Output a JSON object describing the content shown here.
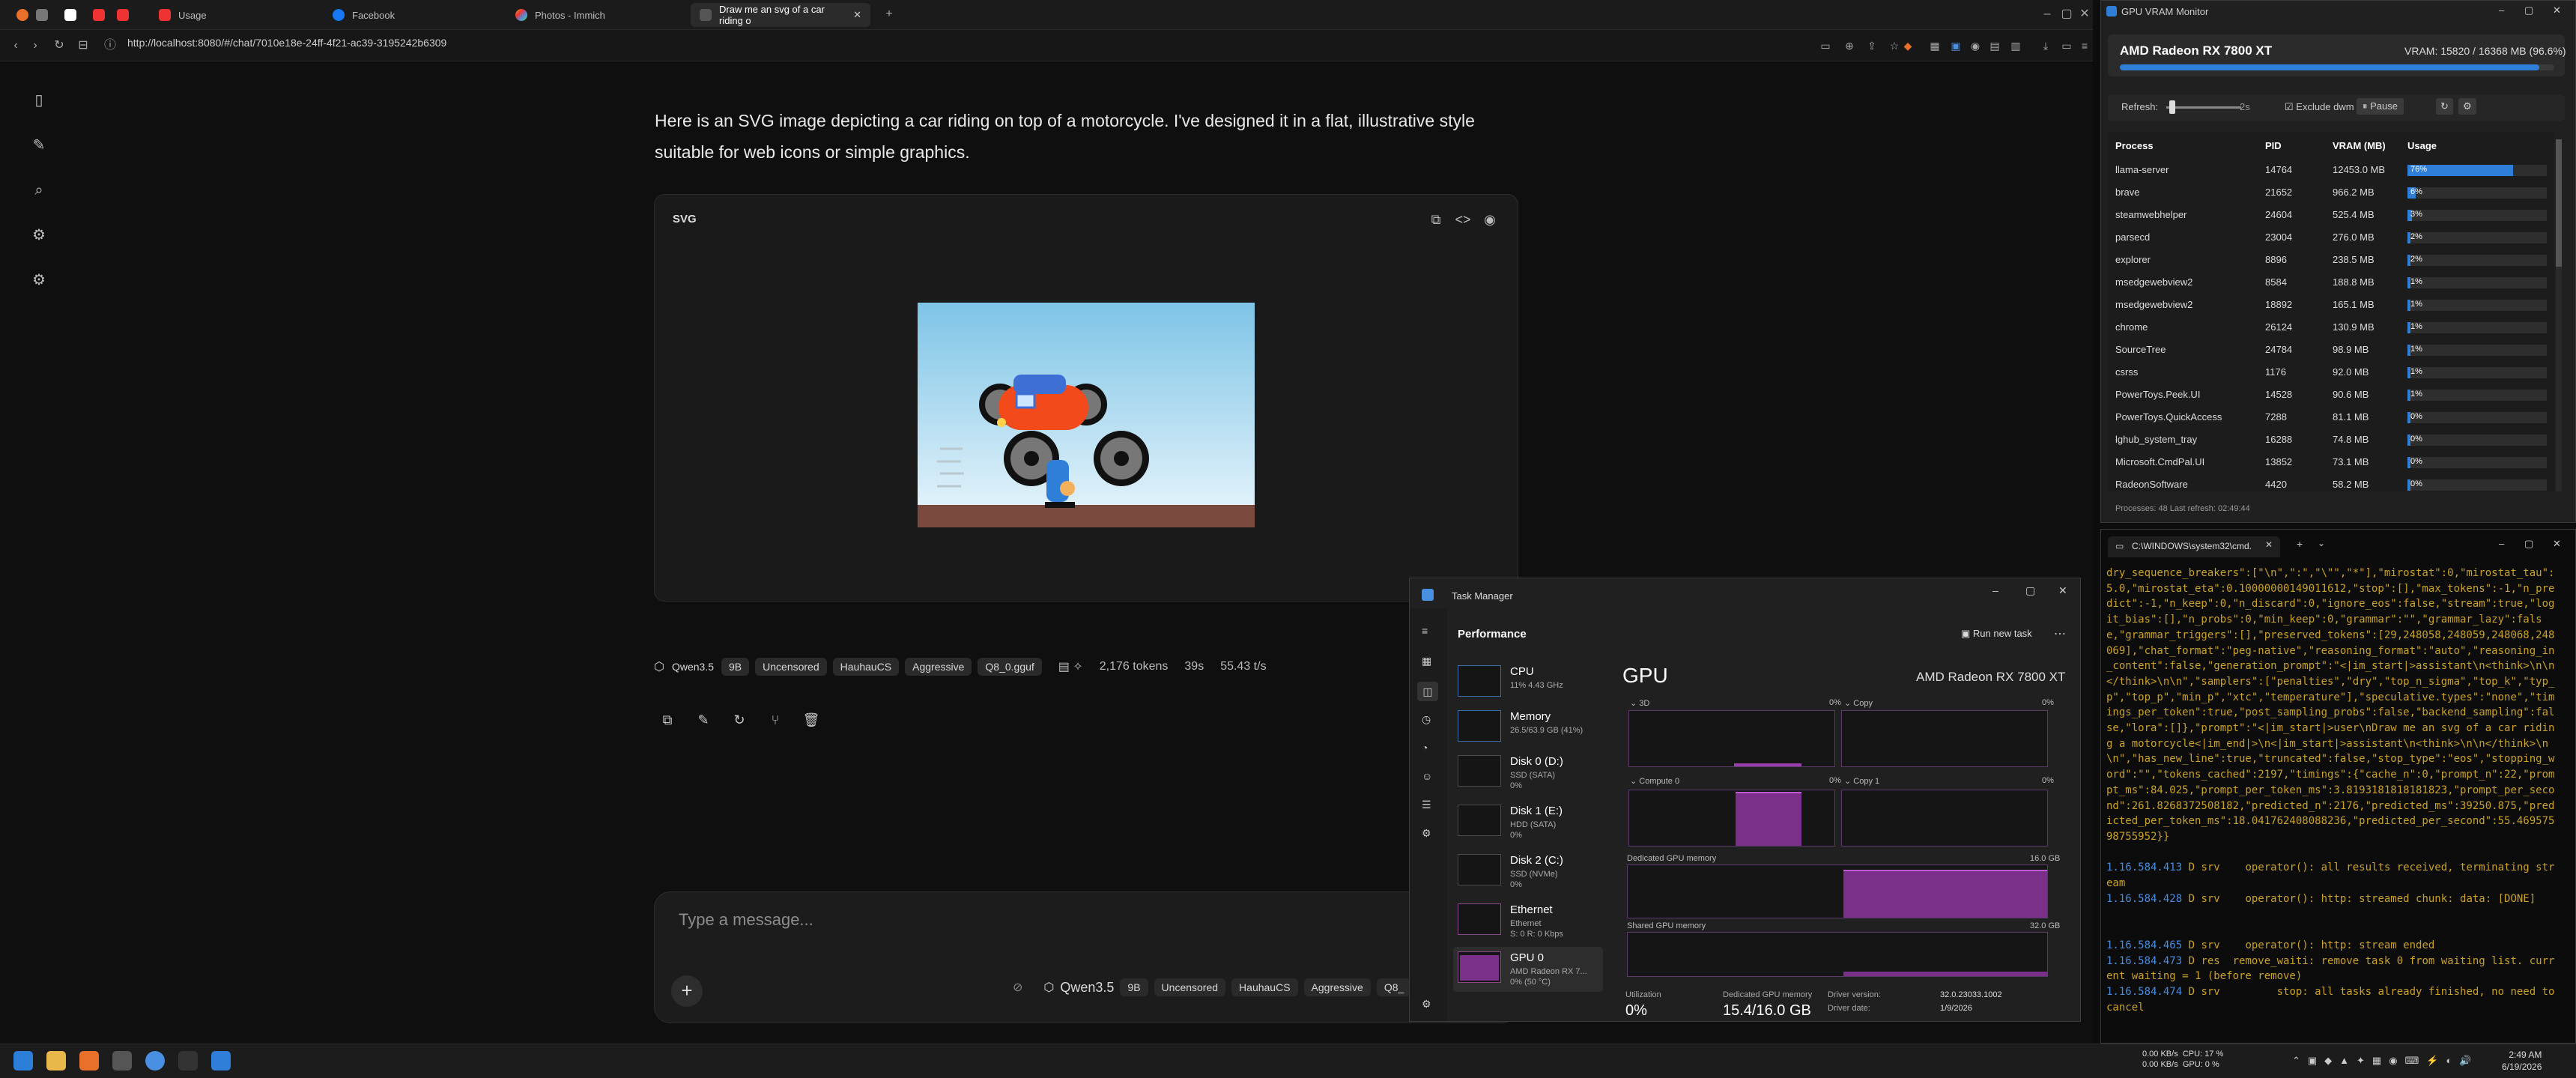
{
  "browser": {
    "tabs": [
      {
        "label": "Usage"
      },
      {
        "label": "Facebook"
      },
      {
        "label": "Photos - Immich"
      },
      {
        "label": "Draw me an svg of a car riding o"
      }
    ],
    "url": "http://localhost:8080/#/chat/7010e18e-24ff-4f21-ac39-3195242b6309"
  },
  "chat": {
    "message": "Here is an SVG image depicting a car riding on top of a motorcycle. I've designed it in a flat, illustrative style suitable for web icons or simple graphics.",
    "card_title": "SVG",
    "meta": {
      "model": "Qwen3.5",
      "size": "9B",
      "tags": [
        "Uncensored",
        "HauhauCS",
        "Aggressive",
        "Q8_0.gguf"
      ],
      "tokens": "2,176 tokens",
      "time": "39s",
      "speed": "55.43 t/s"
    },
    "composer": {
      "placeholder": "Type a message...",
      "model": "Qwen3.5",
      "size": "9B",
      "tags": [
        "Uncensored",
        "HauhauCS",
        "Aggressive",
        "Q8_"
      ]
    }
  },
  "gpu_monitor": {
    "title": "GPU VRAM Monitor",
    "gpu_name": "AMD Radeon RX 7800 XT",
    "vram_text": "VRAM: 15820 / 16368 MB (96.6%)",
    "vram_fraction": 0.966,
    "refresh_label": "Refresh:",
    "refresh_value": "2s",
    "exclude_label": "Exclude dwm",
    "pause_label": "Pause",
    "columns": [
      "Process",
      "PID",
      "VRAM (MB)",
      "Usage"
    ],
    "rows": [
      {
        "name": "llama-server",
        "pid": "14764",
        "vram": "12453.0 MB",
        "usage": "76%",
        "pct": 76
      },
      {
        "name": "brave",
        "pid": "21652",
        "vram": "966.2 MB",
        "usage": "6%",
        "pct": 6
      },
      {
        "name": "steamwebhelper",
        "pid": "24604",
        "vram": "525.4 MB",
        "usage": "3%",
        "pct": 3
      },
      {
        "name": "parsecd",
        "pid": "23004",
        "vram": "276.0 MB",
        "usage": "2%",
        "pct": 2
      },
      {
        "name": "explorer",
        "pid": "8896",
        "vram": "238.5 MB",
        "usage": "2%",
        "pct": 2
      },
      {
        "name": "msedgewebview2",
        "pid": "8584",
        "vram": "188.8 MB",
        "usage": "1%",
        "pct": 1
      },
      {
        "name": "msedgewebview2",
        "pid": "18892",
        "vram": "165.1 MB",
        "usage": "1%",
        "pct": 1
      },
      {
        "name": "chrome",
        "pid": "26124",
        "vram": "130.9 MB",
        "usage": "1%",
        "pct": 1
      },
      {
        "name": "SourceTree",
        "pid": "24784",
        "vram": "98.9 MB",
        "usage": "1%",
        "pct": 1
      },
      {
        "name": "csrss",
        "pid": "1176",
        "vram": "92.0 MB",
        "usage": "1%",
        "pct": 1
      },
      {
        "name": "PowerToys.Peek.UI",
        "pid": "14528",
        "vram": "90.6 MB",
        "usage": "1%",
        "pct": 1
      },
      {
        "name": "PowerToys.QuickAccess",
        "pid": "7288",
        "vram": "81.1 MB",
        "usage": "0%",
        "pct": 0
      },
      {
        "name": "lghub_system_tray",
        "pid": "16288",
        "vram": "74.8 MB",
        "usage": "0%",
        "pct": 0
      },
      {
        "name": "Microsoft.CmdPal.UI",
        "pid": "13852",
        "vram": "73.1 MB",
        "usage": "0%",
        "pct": 0
      },
      {
        "name": "RadeonSoftware",
        "pid": "4420",
        "vram": "58.2 MB",
        "usage": "0%",
        "pct": 0
      }
    ],
    "footer": "Processes: 48     Last refresh: 02:49:44"
  },
  "cmd": {
    "title": "C:\\WINDOWS\\system32\\cmd.",
    "lines": [
      {
        "ts": "",
        "text": "dry_sequence_breakers\":[\"\\n\",\":\",\"\\\"\",\"*\"],\"mirostat\":0,\"mirostat_tau\":5.0,\"mirostat_eta\":0.10000000149011612,\"stop\":[],\"max_tokens\":-1,\"n_predict\":-1,\"n_keep\":0,\"n_discard\":0,\"ignore_eos\":false,\"stream\":true,\"logit_bias\":[],\"n_probs\":0,\"min_keep\":0,\"grammar\":\"\",\"grammar_lazy\":false,\"grammar_triggers\":[],\"preserved_tokens\":[29,248058,248059,248068,248069],\"chat_format\":\"peg-native\",\"reasoning_format\":\"auto\",\"reasoning_in_content\":false,\"generation_prompt\":\"<|im_start|>assistant\\n<think>\\n\\n</think>\\n\\n\",\"samplers\":[\"penalties\",\"dry\",\"top_n_sigma\",\"top_k\",\"typ_p\",\"top_p\",\"min_p\",\"xtc\",\"temperature\"],\"speculative.types\":\"none\",\"timings_per_token\":true,\"post_sampling_probs\":false,\"backend_sampling\":false,\"lora\":[]},\"prompt\":\"<|im_start|>user\\nDraw me an svg of a car riding a motorcycle<|im_end|>\\n<|im_start|>assistant\\n<think>\\n\\n</think>\\n\\n\",\"has_new_line\":true,\"truncated\":false,\"stop_type\":\"eos\",\"stopping_word\":\"\",\"tokens_cached\":2197,\"timings\":{\"cache_n\":0,\"prompt_n\":22,\"prompt_ms\":84.025,\"prompt_per_token_ms\":3.8193181818181823,\"prompt_per_second\":261.8268372508182,\"predicted_n\":2176,\"predicted_ms\":39250.875,\"predicted_per_token_ms\":18.041762408088236,\"predicted_per_second\":55.46957598755952}}"
      },
      {
        "ts": "",
        "text": ""
      },
      {
        "ts": "1.16.584.413",
        "text": " D srv    operator(): all results received, terminating stream"
      },
      {
        "ts": "1.16.584.428",
        "text": " D srv    operator(): http: streamed chunk: data: [DONE]"
      },
      {
        "ts": "",
        "text": ""
      },
      {
        "ts": "",
        "text": ""
      },
      {
        "ts": "1.16.584.465",
        "text": " D srv    operator(): http: stream ended"
      },
      {
        "ts": "1.16.584.473",
        "text": " D res  remove_waiti: remove task 0 from waiting list. current waiting = 1 (before remove)"
      },
      {
        "ts": "1.16.584.474",
        "text": " D srv         stop: all tasks already finished, no need to cancel"
      }
    ]
  },
  "task_manager": {
    "title": "Task Manager",
    "section": "Performance",
    "run_task": "Run new task",
    "items": [
      {
        "name": "CPU",
        "sub": "11% 4.43 GHz"
      },
      {
        "name": "Memory",
        "sub": "26.5/63.9 GB (41%)"
      },
      {
        "name": "Disk 0 (D:)",
        "sub": "SSD (SATA)\n0%"
      },
      {
        "name": "Disk 1 (E:)",
        "sub": "HDD (SATA)\n0%"
      },
      {
        "name": "Disk 2 (C:)",
        "sub": "SSD (NVMe)\n0%"
      },
      {
        "name": "Ethernet",
        "sub": "Ethernet\nS: 0 R: 0 Kbps"
      },
      {
        "name": "GPU 0",
        "sub": "AMD Radeon RX 7...\n0% (50 °C)"
      }
    ],
    "gpu_title": "GPU",
    "gpu_model": "AMD Radeon RX 7800 XT",
    "graphs": {
      "g3d": "3D",
      "g3d_pct": "0%",
      "copy": "Copy",
      "copy_pct": "0%",
      "compute0": "Compute 0",
      "compute0_pct": "0%",
      "copy1": "Copy 1",
      "copy1_pct": "0%",
      "dedicated": "Dedicated GPU memory",
      "dedicated_max": "16.0 GB",
      "shared": "Shared GPU memory",
      "shared_max": "32.0 GB"
    },
    "stats": {
      "util_label": "Utilization",
      "util_value": "0%",
      "ded_label": "Dedicated GPU memory",
      "ded_value": "15.4/16.0 GB",
      "driver_label": "Driver version:",
      "driver_value": "32.0.23033.1002",
      "date_label": "Driver date:",
      "date_value": "1/9/2026"
    }
  },
  "taskbar": {
    "net_up": "0.00 KB/s",
    "net_down": "0.00 KB/s",
    "cpu": "CPU: 17 %",
    "gpu": "GPU: 0 %",
    "time": "2:49 AM",
    "date": "6/19/2026"
  }
}
